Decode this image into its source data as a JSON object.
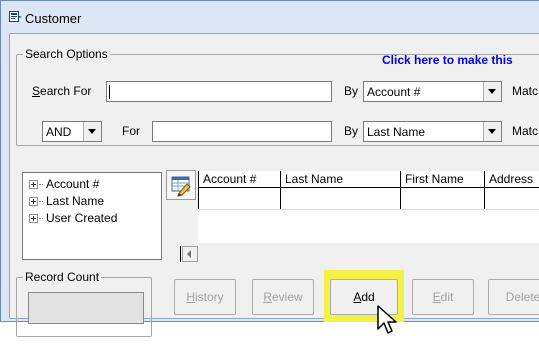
{
  "window": {
    "title": "Customer"
  },
  "search_options": {
    "legend": "Search Options",
    "link_text": "Click here to make this",
    "row1": {
      "search_for_label_u": "S",
      "search_for_label_rest": "earch For",
      "value": "",
      "by_label": "By",
      "by_value": "Account #",
      "match_label": "Matc"
    },
    "row2": {
      "logic_value": "AND",
      "for_label": "For",
      "value": "",
      "by_label": "By",
      "by_value": "Last Name",
      "match_label": "Matc"
    }
  },
  "tree": {
    "items": [
      "Account #",
      "Last Name",
      "User Created"
    ]
  },
  "grid": {
    "columns": [
      "Account #",
      "Last Name",
      "First Name",
      "Address"
    ]
  },
  "record_count": {
    "legend": "Record Count",
    "value": ""
  },
  "buttons": {
    "history_u": "H",
    "history_rest": "istory",
    "review_u": "R",
    "review_rest": "eview",
    "add_u": "A",
    "add_rest": "dd",
    "edit_u": "E",
    "edit_rest": "dit",
    "delete_label": "Delete"
  },
  "colors": {
    "link": "#0000dd",
    "highlight": "#f3f048",
    "frame": "#dbe7f5"
  },
  "icons": [
    "window-icon",
    "edit-grid-icon",
    "chevron-down-icon",
    "scroll-left-icon",
    "mouse-cursor-icon"
  ]
}
